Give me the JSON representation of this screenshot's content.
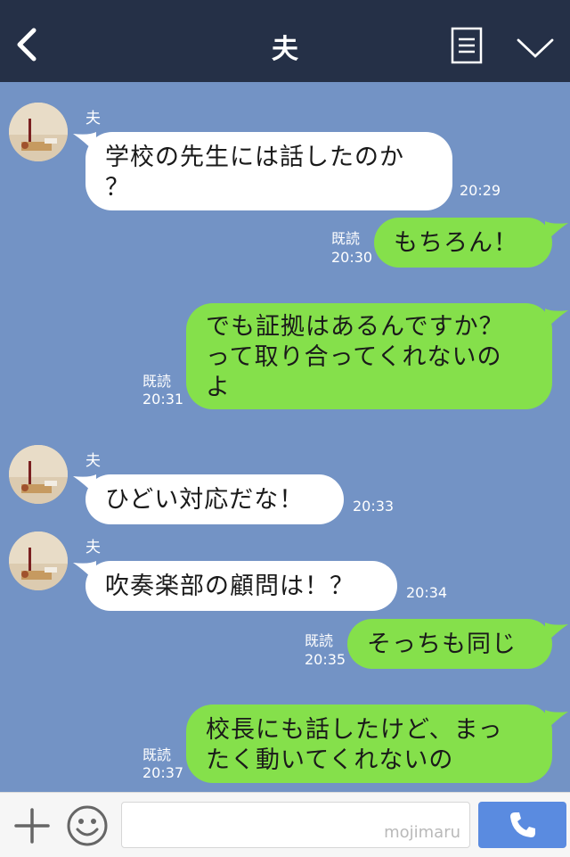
{
  "header": {
    "title": "夫"
  },
  "messages": [
    {
      "side": "in",
      "sender": "夫",
      "text": "学校の先生には話したのか\n？",
      "time": "20:29"
    },
    {
      "side": "out",
      "read": "既読",
      "text": "もちろん！",
      "time": "20:30"
    },
    {
      "side": "out",
      "read": "既読",
      "text": "でも証拠はあるんですか？\nって取り合ってくれないの\nよ",
      "time": "20:31"
    },
    {
      "side": "in",
      "sender": "夫",
      "text": "ひどい対応だな！",
      "time": "20:33"
    },
    {
      "side": "in",
      "sender": "夫",
      "text": "吹奏楽部の顧問は！？",
      "time": "20:34"
    },
    {
      "side": "out",
      "read": "既読",
      "text": "そっちも同じ",
      "time": "20:35"
    },
    {
      "side": "out",
      "read": "既読",
      "text": "校長にも話したけど、まっ\nたく動いてくれないの",
      "time": "20:37"
    }
  ],
  "footer": {
    "input_value": "",
    "watermark": "mojimaru"
  },
  "colors": {
    "header_bg": "#253047",
    "chat_bg": "#7393c5",
    "outgoing": "#85e04b",
    "incoming": "#ffffff",
    "send": "#5a8be0"
  },
  "icons": [
    "back-icon",
    "menu-icon",
    "chevron-down-icon",
    "plus-icon",
    "smiley-icon",
    "phone-icon"
  ]
}
